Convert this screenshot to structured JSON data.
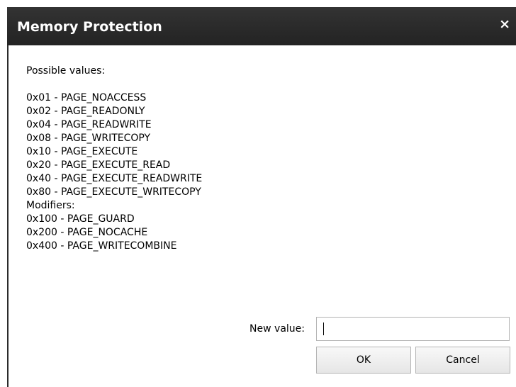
{
  "dialog": {
    "title": "Memory Protection",
    "close_glyph": "×"
  },
  "body": {
    "intro": "Possible values:",
    "values": [
      "0x01 - PAGE_NOACCESS",
      "0x02 - PAGE_READONLY",
      "0x04 - PAGE_READWRITE",
      "0x08 - PAGE_WRITECOPY",
      "0x10 - PAGE_EXECUTE",
      "0x20 - PAGE_EXECUTE_READ",
      "0x40 - PAGE_EXECUTE_READWRITE",
      "0x80 - PAGE_EXECUTE_WRITECOPY",
      "Modifiers:",
      "0x100 - PAGE_GUARD",
      "0x200 - PAGE_NOCACHE",
      "0x400 - PAGE_WRITECOMBINE"
    ]
  },
  "form": {
    "new_value_label": "New value:",
    "new_value": "",
    "ok_label": "OK",
    "cancel_label": "Cancel"
  },
  "colors": {
    "titlebar": "#2b2b2b",
    "title_text": "#ffffff",
    "background": "#ffffff"
  }
}
